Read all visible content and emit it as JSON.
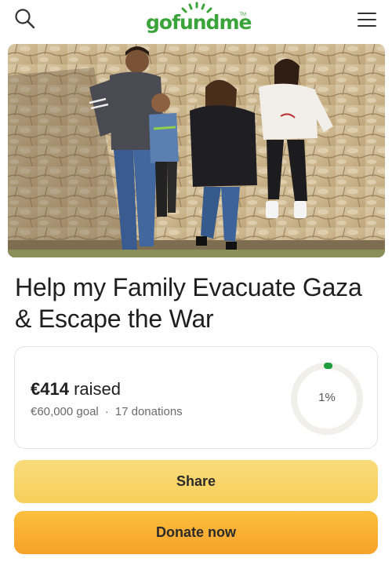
{
  "header": {
    "logo_text": "gofundme",
    "logo_mark": "TM",
    "search_icon": "search-icon",
    "menu_icon": "hamburger-menu-icon"
  },
  "campaign": {
    "title": "Help my Family Evacuate Gaza & Escape the War",
    "raised_amount": "€414",
    "raised_suffix": "raised",
    "goal_text": "€60,000 goal",
    "separator": "·",
    "donations_text": "17 donations",
    "progress_label": "1%",
    "progress_fraction": 0.01
  },
  "actions": {
    "share_label": "Share",
    "donate_label": "Donate now"
  },
  "colors": {
    "brand_green": "#3aa43a",
    "share_yellow": "#f7cf5a",
    "donate_orange": "#f7a12a",
    "progress_green": "#1f9d3a"
  }
}
